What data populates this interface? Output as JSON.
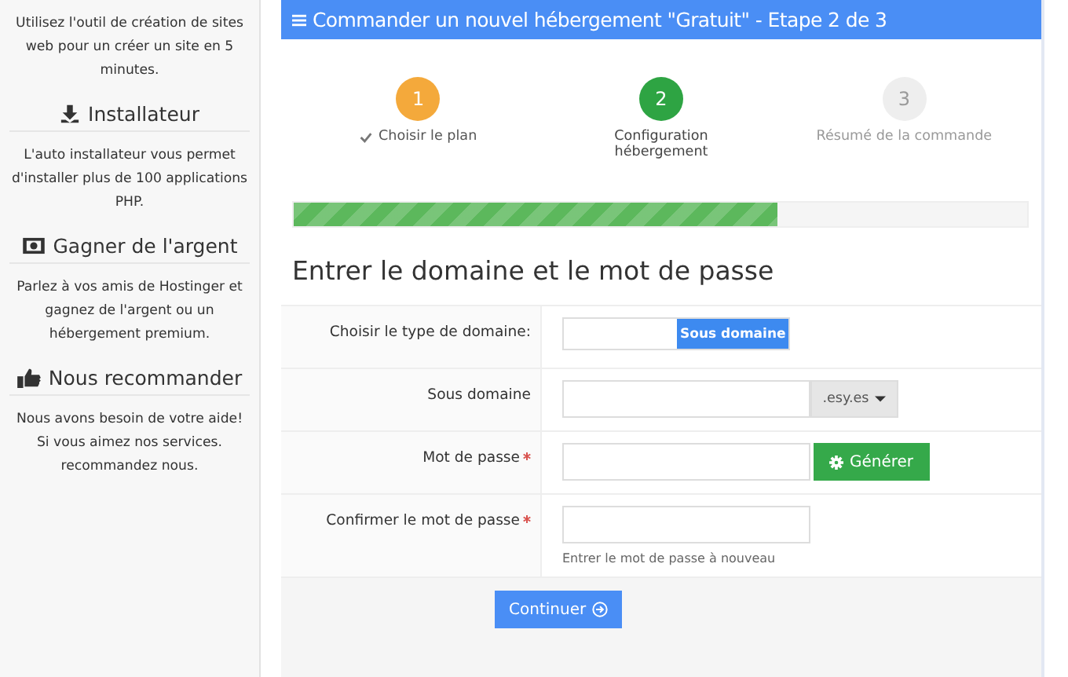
{
  "sidebar": {
    "intro": "Utilisez l'outil de création de sites web pour un créer un site en 5 minutes.",
    "sections": [
      {
        "title": "Installateur",
        "text": "L'auto installateur vous permet d'installer plus de 100 applications PHP."
      },
      {
        "title": "Gagner de l'argent",
        "text": "Parlez à vos amis de Hostinger et gagnez de l'argent ou un hébergement premium."
      },
      {
        "title": "Nous recommander",
        "text": "Nous avons besoin de votre aide! Si vous aimez nos services. recommandez nous."
      }
    ]
  },
  "panel": {
    "title": "Commander un nouvel hébergement \"Gratuit\" - Etape 2 de 3",
    "steps": [
      {
        "number": "1",
        "label": "Choisir le plan",
        "kind": "done"
      },
      {
        "number": "2",
        "label": "Configuration hébergement",
        "kind": "current"
      },
      {
        "number": "3",
        "label": "Résumé de la commande",
        "kind": "pending"
      }
    ],
    "progress": {
      "level": 0.66
    },
    "heading": "Entrer le domaine et le mot de passe",
    "fields": [
      {
        "kind": "toggle",
        "label": "Choisir le type de domaine:",
        "required": false,
        "option": "Sous domaine"
      },
      {
        "kind": "suffix",
        "label": "Sous domaine",
        "required": false,
        "suffix": ".esy.es"
      },
      {
        "kind": "generate",
        "label": "Mot de passe",
        "required": true,
        "button": "Générer"
      },
      {
        "kind": "plain",
        "label": "Confirmer le mot de passe",
        "required": true,
        "help": "Entrer le mot de passe à nouveau"
      }
    ],
    "submit": "Continuer"
  }
}
